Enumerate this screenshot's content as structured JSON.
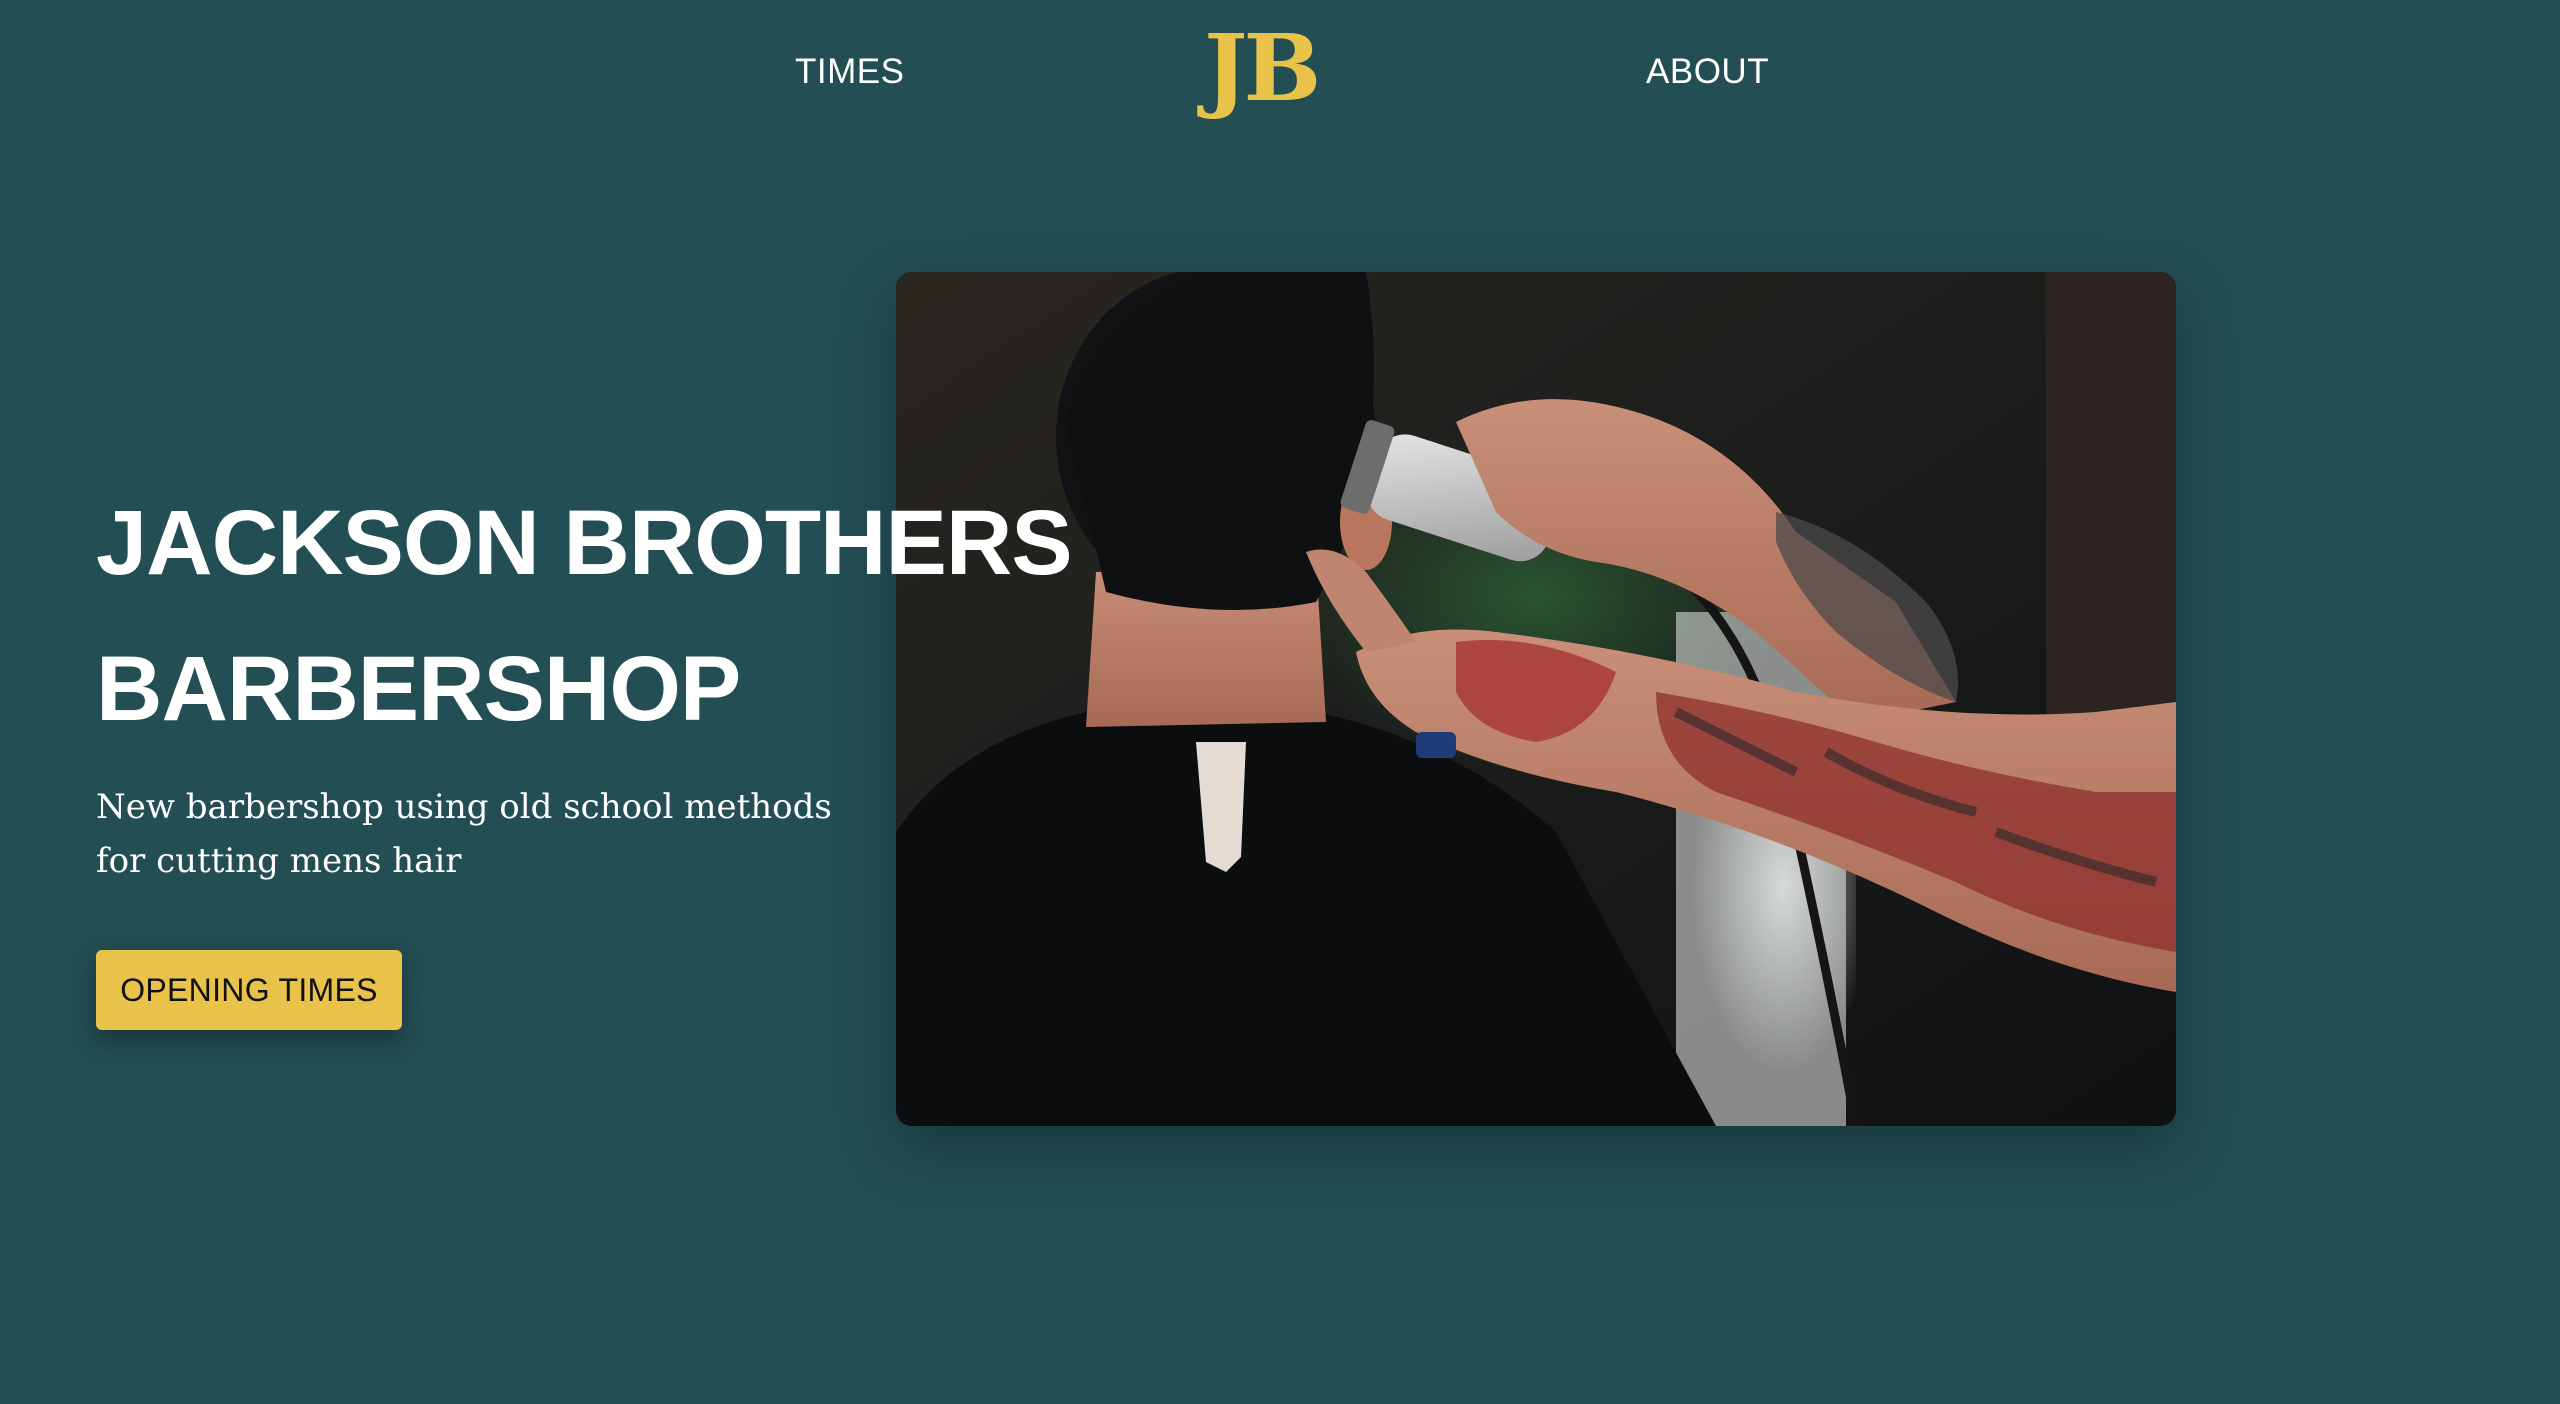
{
  "nav": {
    "times_label": "TIMES",
    "logo_text": "JB",
    "about_label": "ABOUT"
  },
  "hero": {
    "title_line1": "JACKSON BROTHERS",
    "title_line2": "BARBERSHOP",
    "description": "New barbershop using old school methods for cutting mens hair",
    "cta_label": "OPENING TIMES",
    "photo_subject": "barber-cutting-hair-photo"
  },
  "colors": {
    "background": "#234e54",
    "accent": "#e9c24a",
    "text": "#ffffff",
    "button_text": "#111111"
  }
}
